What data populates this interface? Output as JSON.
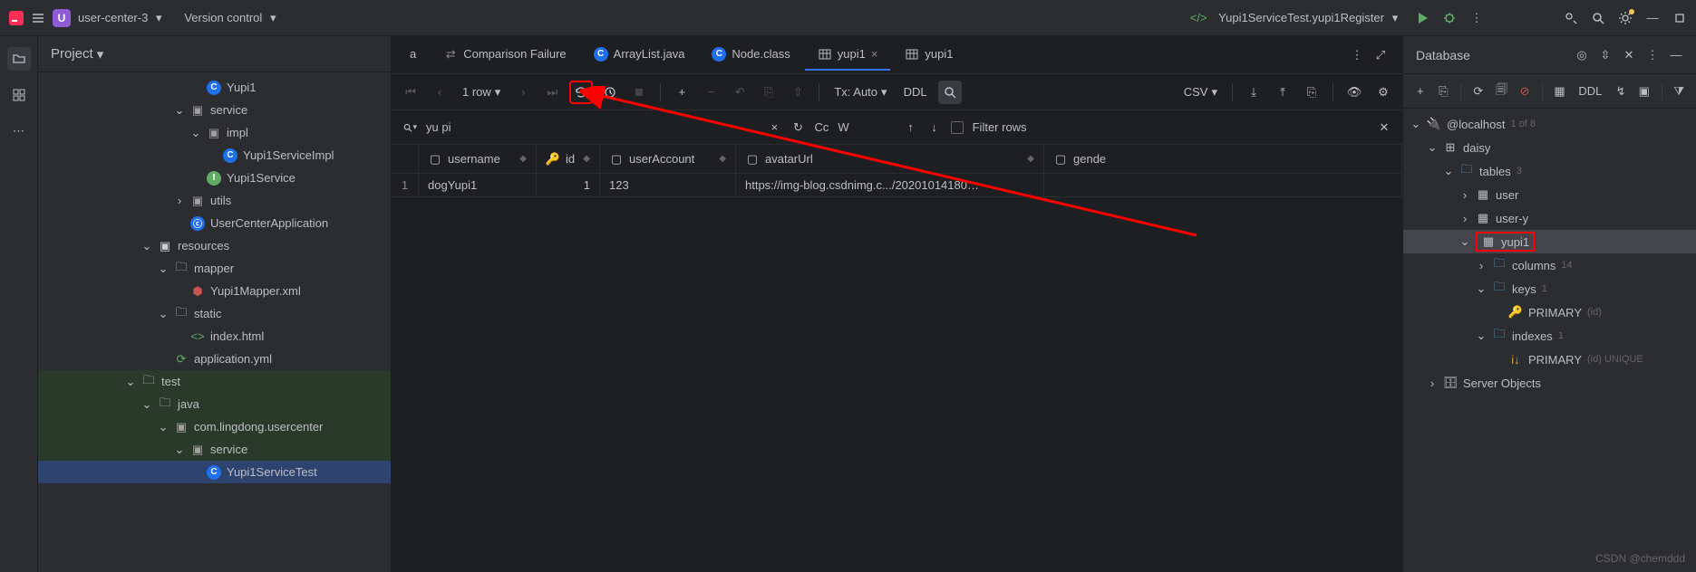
{
  "topbar": {
    "project_badge": "U",
    "project_name": "user-center-3",
    "vcs_label": "Version control",
    "run_config": "Yupi1ServiceTest.yupi1Register"
  },
  "project_panel": {
    "title": "Project",
    "tree": {
      "yupi1_cls": "Yupi1",
      "service": "service",
      "impl": "impl",
      "impl_cls": "Yupi1ServiceImpl",
      "svc_intf": "Yupi1Service",
      "utils": "utils",
      "app_cls": "UserCenterApplication",
      "resources": "resources",
      "mapper": "mapper",
      "mapper_xml": "Yupi1Mapper.xml",
      "static": "static",
      "index_html": "index.html",
      "app_yml": "application.yml",
      "test": "test",
      "java": "java",
      "pkg": "com.lingdong.usercenter",
      "svc_dir": "service",
      "svc_test": "Yupi1ServiceTest"
    }
  },
  "tabs": {
    "t0_suffix": "a",
    "t1": "Comparison Failure",
    "t2": "ArrayList.java",
    "t3": "Node.class",
    "t4": "yupi1",
    "t5": "yupi1"
  },
  "toolbar": {
    "rows": "1 row",
    "tx": "Tx: Auto",
    "ddl": "DDL",
    "csv": "CSV"
  },
  "search": {
    "query": "yu pi",
    "cc": "Cc",
    "w": "W",
    "filter": "Filter rows"
  },
  "grid": {
    "cols": {
      "username": "username",
      "id": "id",
      "userAccount": "userAccount",
      "avatarUrl": "avatarUrl",
      "gender": "gende"
    },
    "row1": {
      "idx": "1",
      "username": "dogYupi1",
      "id": "1",
      "userAccount": "123",
      "avatarUrl": "https://img-blog.csdnimg.c.../20201014180…"
    }
  },
  "dbpanel": {
    "title": "Database",
    "ddl": "DDL",
    "host": "@localhost",
    "host_count": "1 of 8",
    "daisy": "daisy",
    "tables": "tables",
    "tables_count": "3",
    "user": "user",
    "usery": "user-y",
    "yupi1": "yupi1",
    "columns": "columns",
    "columns_count": "14",
    "keys": "keys",
    "keys_count": "1",
    "primary": "PRIMARY",
    "primary_hint": "(id)",
    "indexes": "indexes",
    "indexes_count": "1",
    "idx_primary": "PRIMARY",
    "idx_hint": "(id) UNIQUE",
    "server_objects": "Server Objects"
  },
  "watermark": "CSDN @chemddd"
}
